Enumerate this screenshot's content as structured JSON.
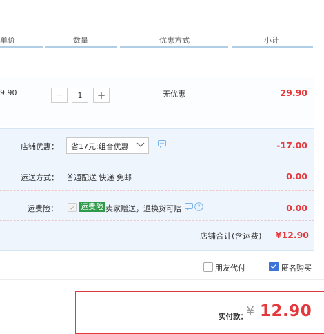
{
  "header": {
    "price_col": "单价",
    "qty_col": "数量",
    "promo_col": "优惠方式",
    "subtotal_col": "小计"
  },
  "item": {
    "unit_price": "9.90",
    "quantity": "1",
    "promo": "无优惠",
    "subtotal": "29.90"
  },
  "shop": {
    "discount_label": "店铺优惠：",
    "discount_selected": "省17元:组合优惠",
    "discount_amount": "-17.00",
    "shipping_label": "运送方式：",
    "shipping_value": "普通配送 快递 免邮",
    "shipping_amount": "0.00",
    "insurance_label": "运费险：",
    "insurance_tag": "运费险",
    "insurance_desc": "卖家赠送，退换货可赔",
    "insurance_amount": "0.00",
    "total_label": "店铺合计(含运费)",
    "total_amount": "¥12.90"
  },
  "options": {
    "friend_pay": "朋友代付",
    "anonymous": "匿名购买",
    "anonymous_checked": true,
    "friend_pay_checked": false
  },
  "payment": {
    "label": "实付款：",
    "currency": "¥",
    "amount": "12.90"
  },
  "colors": {
    "accent_red": "#e4393c",
    "panel_blue": "#eef5fd",
    "header_line": "#b0cfe6",
    "dashed_pink": "#f4c6c6",
    "tag_green": "#2e9a4a",
    "check_blue": "#3a73d9"
  }
}
